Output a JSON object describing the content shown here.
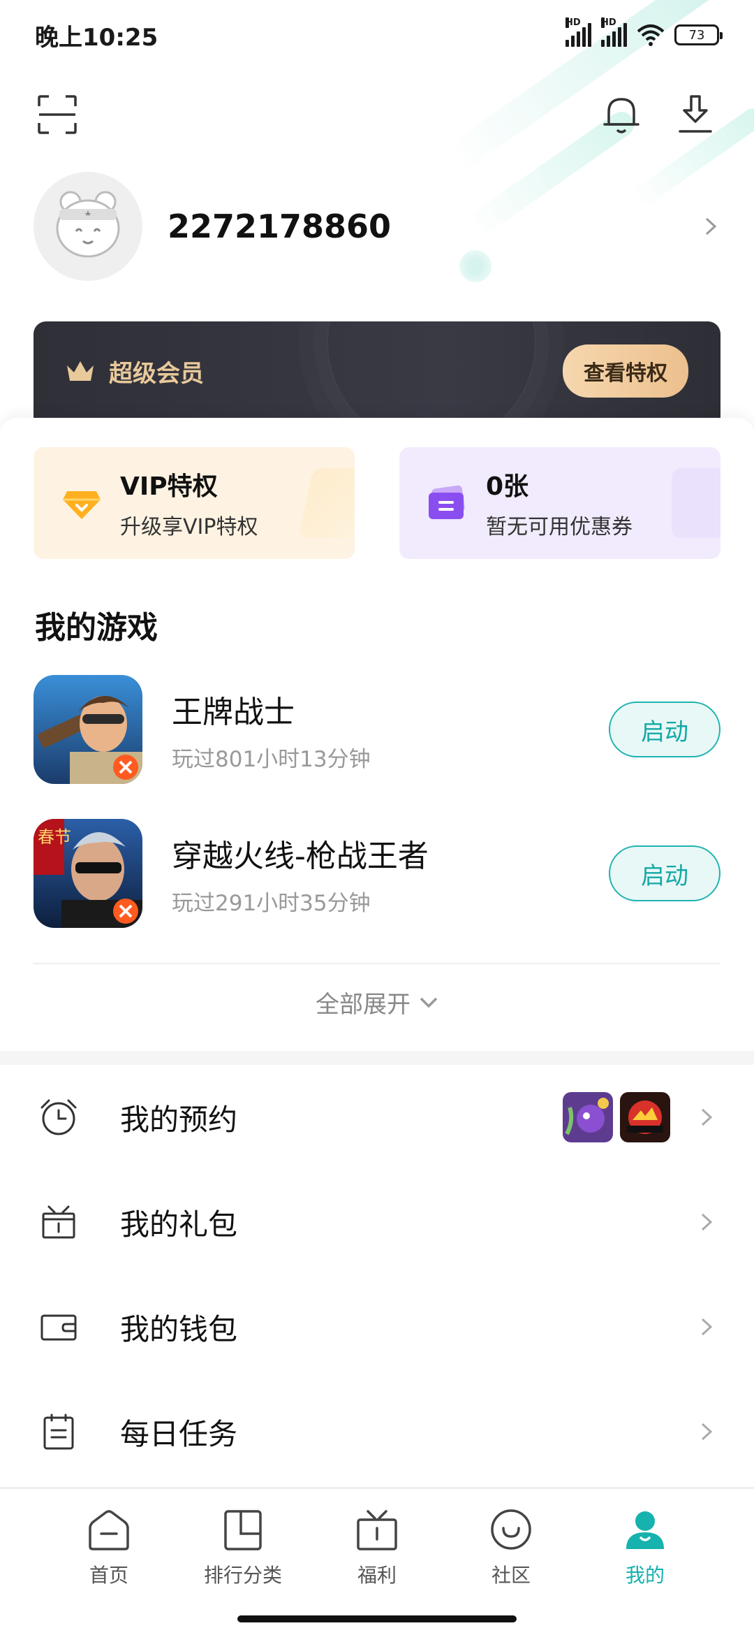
{
  "status_bar": {
    "time": "晚上10:25",
    "battery": "73",
    "hd1": "HD",
    "hd2": "HD"
  },
  "profile": {
    "user_id": "2272178860"
  },
  "vip_banner": {
    "title": "超级会员",
    "button": "查看特权"
  },
  "perks": [
    {
      "title": "VIP特权",
      "subtitle": "升级享VIP特权"
    },
    {
      "title": "0张",
      "subtitle": "暂无可用优惠券"
    }
  ],
  "my_games": {
    "title": "我的游戏",
    "items": [
      {
        "name": "王牌战士",
        "played": "玩过801小时13分钟",
        "action": "启动"
      },
      {
        "name": "穿越火线-枪战王者",
        "played": "玩过291小时35分钟",
        "action": "启动"
      }
    ],
    "expand": "全部展开"
  },
  "badge_text": "春节",
  "menu": [
    {
      "label": "我的预约",
      "icon": "alarm-clock-icon"
    },
    {
      "label": "我的礼包",
      "icon": "gift-box-icon"
    },
    {
      "label": "我的钱包",
      "icon": "wallet-icon"
    },
    {
      "label": "每日任务",
      "icon": "calendar-task-icon"
    }
  ],
  "tabbar": [
    {
      "label": "首页",
      "icon": "home-icon"
    },
    {
      "label": "排行分类",
      "icon": "ranking-icon"
    },
    {
      "label": "福利",
      "icon": "gift-icon"
    },
    {
      "label": "社区",
      "icon": "community-icon"
    },
    {
      "label": "我的",
      "icon": "profile-icon",
      "active": true
    }
  ],
  "colors": {
    "accent": "#16b2ad",
    "vip_gold": "#e8c99a",
    "vip_dark": "#34343d"
  }
}
